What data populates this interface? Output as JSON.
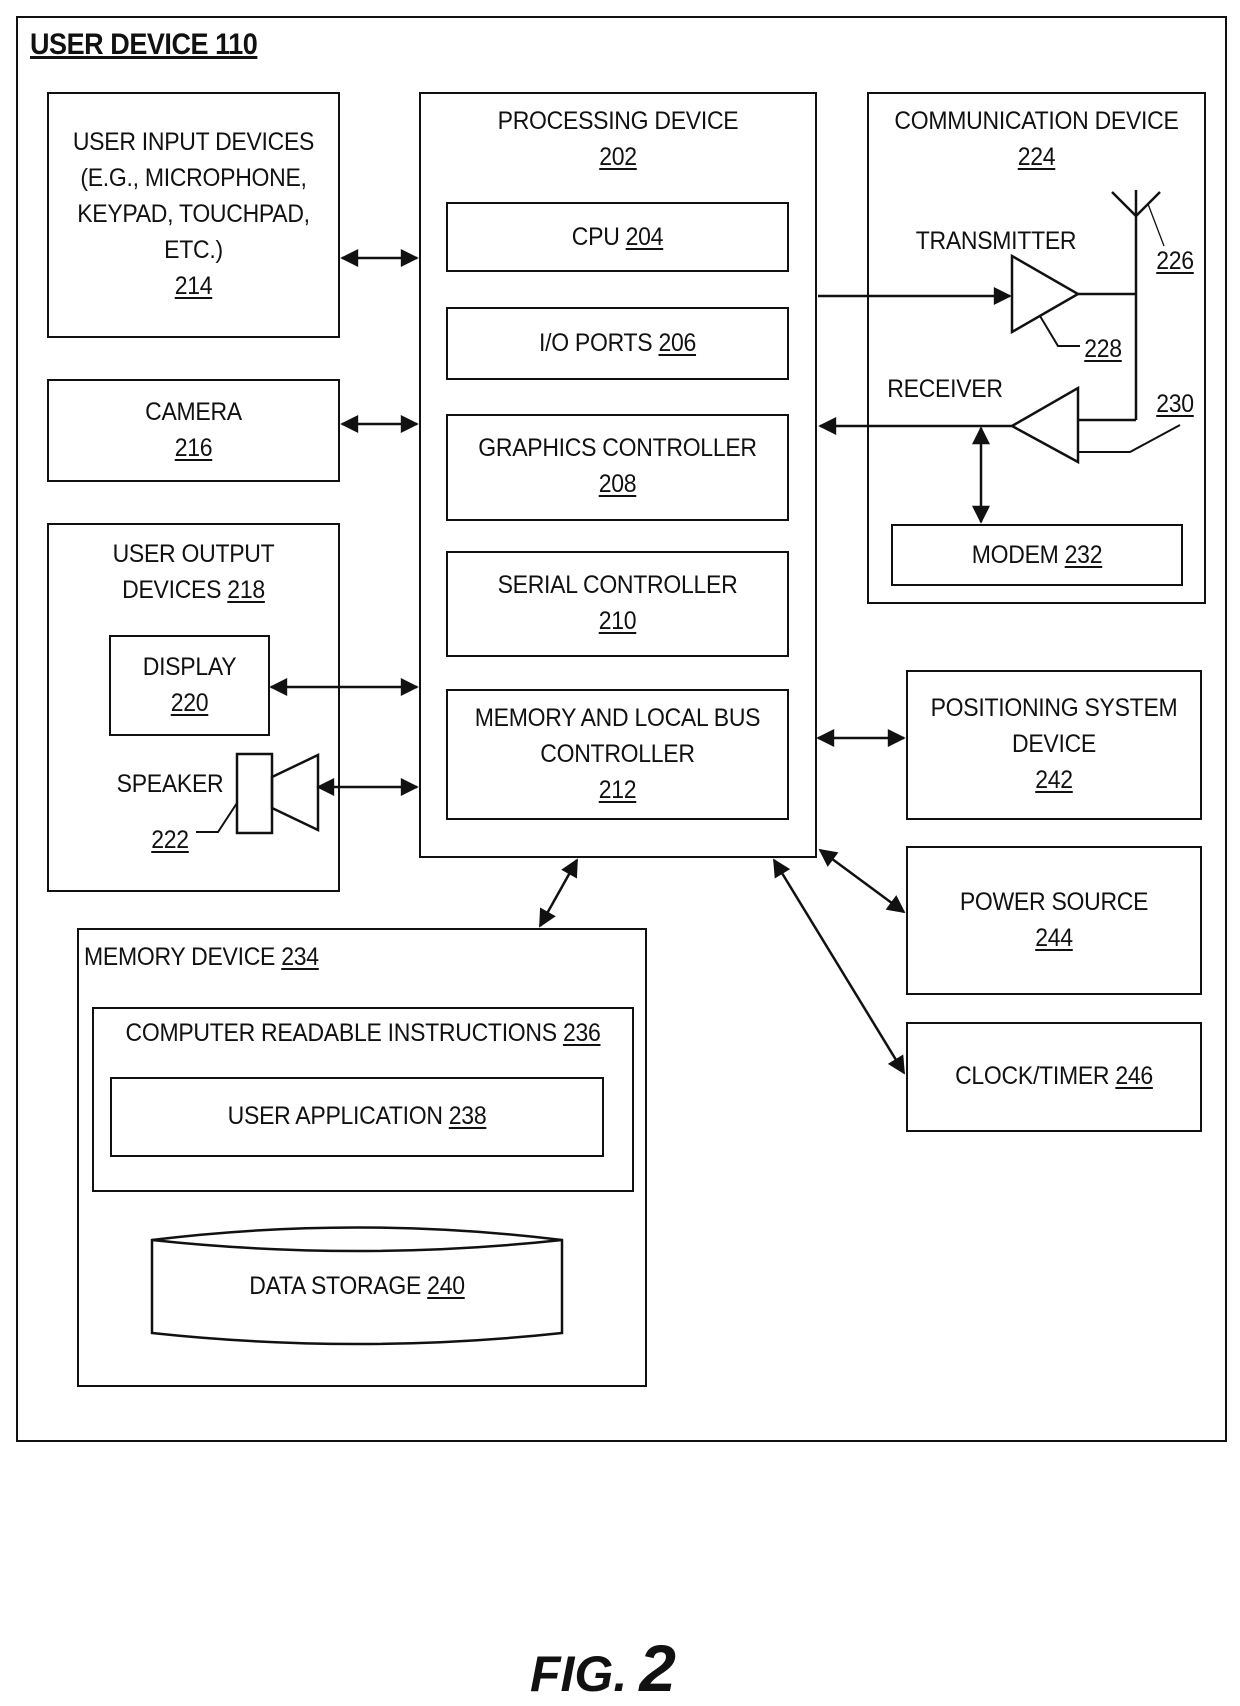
{
  "title": "USER DEVICE 110",
  "figure": {
    "prefix": "FIG.",
    "number": "2"
  },
  "blocks": {
    "user_input": {
      "lines": [
        "USER INPUT DEVICES",
        "(E.G., MICROPHONE,",
        "KEYPAD, TOUCHPAD,",
        "ETC.)"
      ],
      "ref": "214"
    },
    "camera": {
      "name": "CAMERA",
      "ref": "216"
    },
    "user_output": {
      "lines": [
        "USER OUTPUT",
        "DEVICES "
      ],
      "ref": "218"
    },
    "display": {
      "name": "DISPLAY",
      "ref": "220"
    },
    "speaker": {
      "name": "SPEAKER",
      "ref": "222"
    },
    "processing": {
      "name": "PROCESSING DEVICE",
      "ref": "202"
    },
    "cpu": {
      "name": "CPU ",
      "ref": "204"
    },
    "io_ports": {
      "name": "I/O PORTS ",
      "ref": "206"
    },
    "graphics": {
      "name": "GRAPHICS CONTROLLER",
      "ref": "208"
    },
    "serial": {
      "name": "SERIAL CONTROLLER",
      "ref": "210"
    },
    "mem_bus": {
      "lines": [
        "MEMORY AND LOCAL BUS",
        "CONTROLLER"
      ],
      "ref": "212"
    },
    "communication": {
      "name": "COMMUNICATION DEVICE",
      "ref": "224"
    },
    "transmitter": {
      "name": "TRANSMITTER",
      "ref": "228"
    },
    "receiver": {
      "name": "RECEIVER",
      "ref": "230"
    },
    "antenna": {
      "ref": "226"
    },
    "modem": {
      "name": "MODEM ",
      "ref": "232"
    },
    "positioning": {
      "lines": [
        "POSITIONING SYSTEM",
        "DEVICE"
      ],
      "ref": "242"
    },
    "power": {
      "name": "POWER SOURCE",
      "ref": "244"
    },
    "clock": {
      "name": "CLOCK/TIMER ",
      "ref": "246"
    },
    "memory_device": {
      "name": "MEMORY DEVICE ",
      "ref": "234"
    },
    "instructions": {
      "name": "COMPUTER READABLE INSTRUCTIONS ",
      "ref": "236"
    },
    "user_app": {
      "name": "USER APPLICATION ",
      "ref": "238"
    },
    "data_storage": {
      "name": "DATA STORAGE ",
      "ref": "240"
    }
  }
}
